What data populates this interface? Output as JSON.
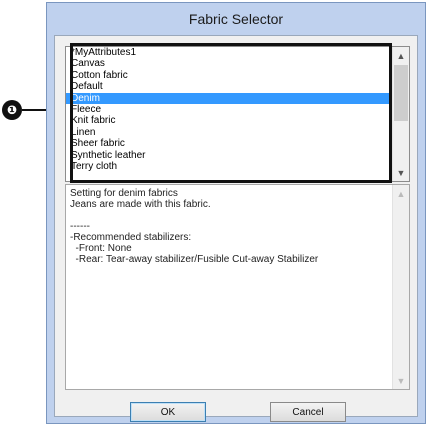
{
  "callout": {
    "number": "❶"
  },
  "dialog": {
    "title": "Fabric Selector",
    "fabrics": [
      "*MyAttributes1",
      "Canvas",
      "Cotton fabric",
      "Default",
      "Denim",
      "Fleece",
      "Knit fabric",
      "Linen",
      "Sheer fabric",
      "Synthetic leather",
      "Terry cloth"
    ],
    "selected_fabric": "Denim",
    "description": "Setting for denim fabrics\nJeans are made with this fabric.\n\n------\n-Recommended stabilizers:\n  -Front: None\n  -Rear: Tear-away stabilizer/Fusible Cut-away Stabilizer",
    "ok_label": "OK",
    "cancel_label": "Cancel"
  },
  "colors": {
    "selection": "#3399ff",
    "frame": "#bfd1ee"
  }
}
